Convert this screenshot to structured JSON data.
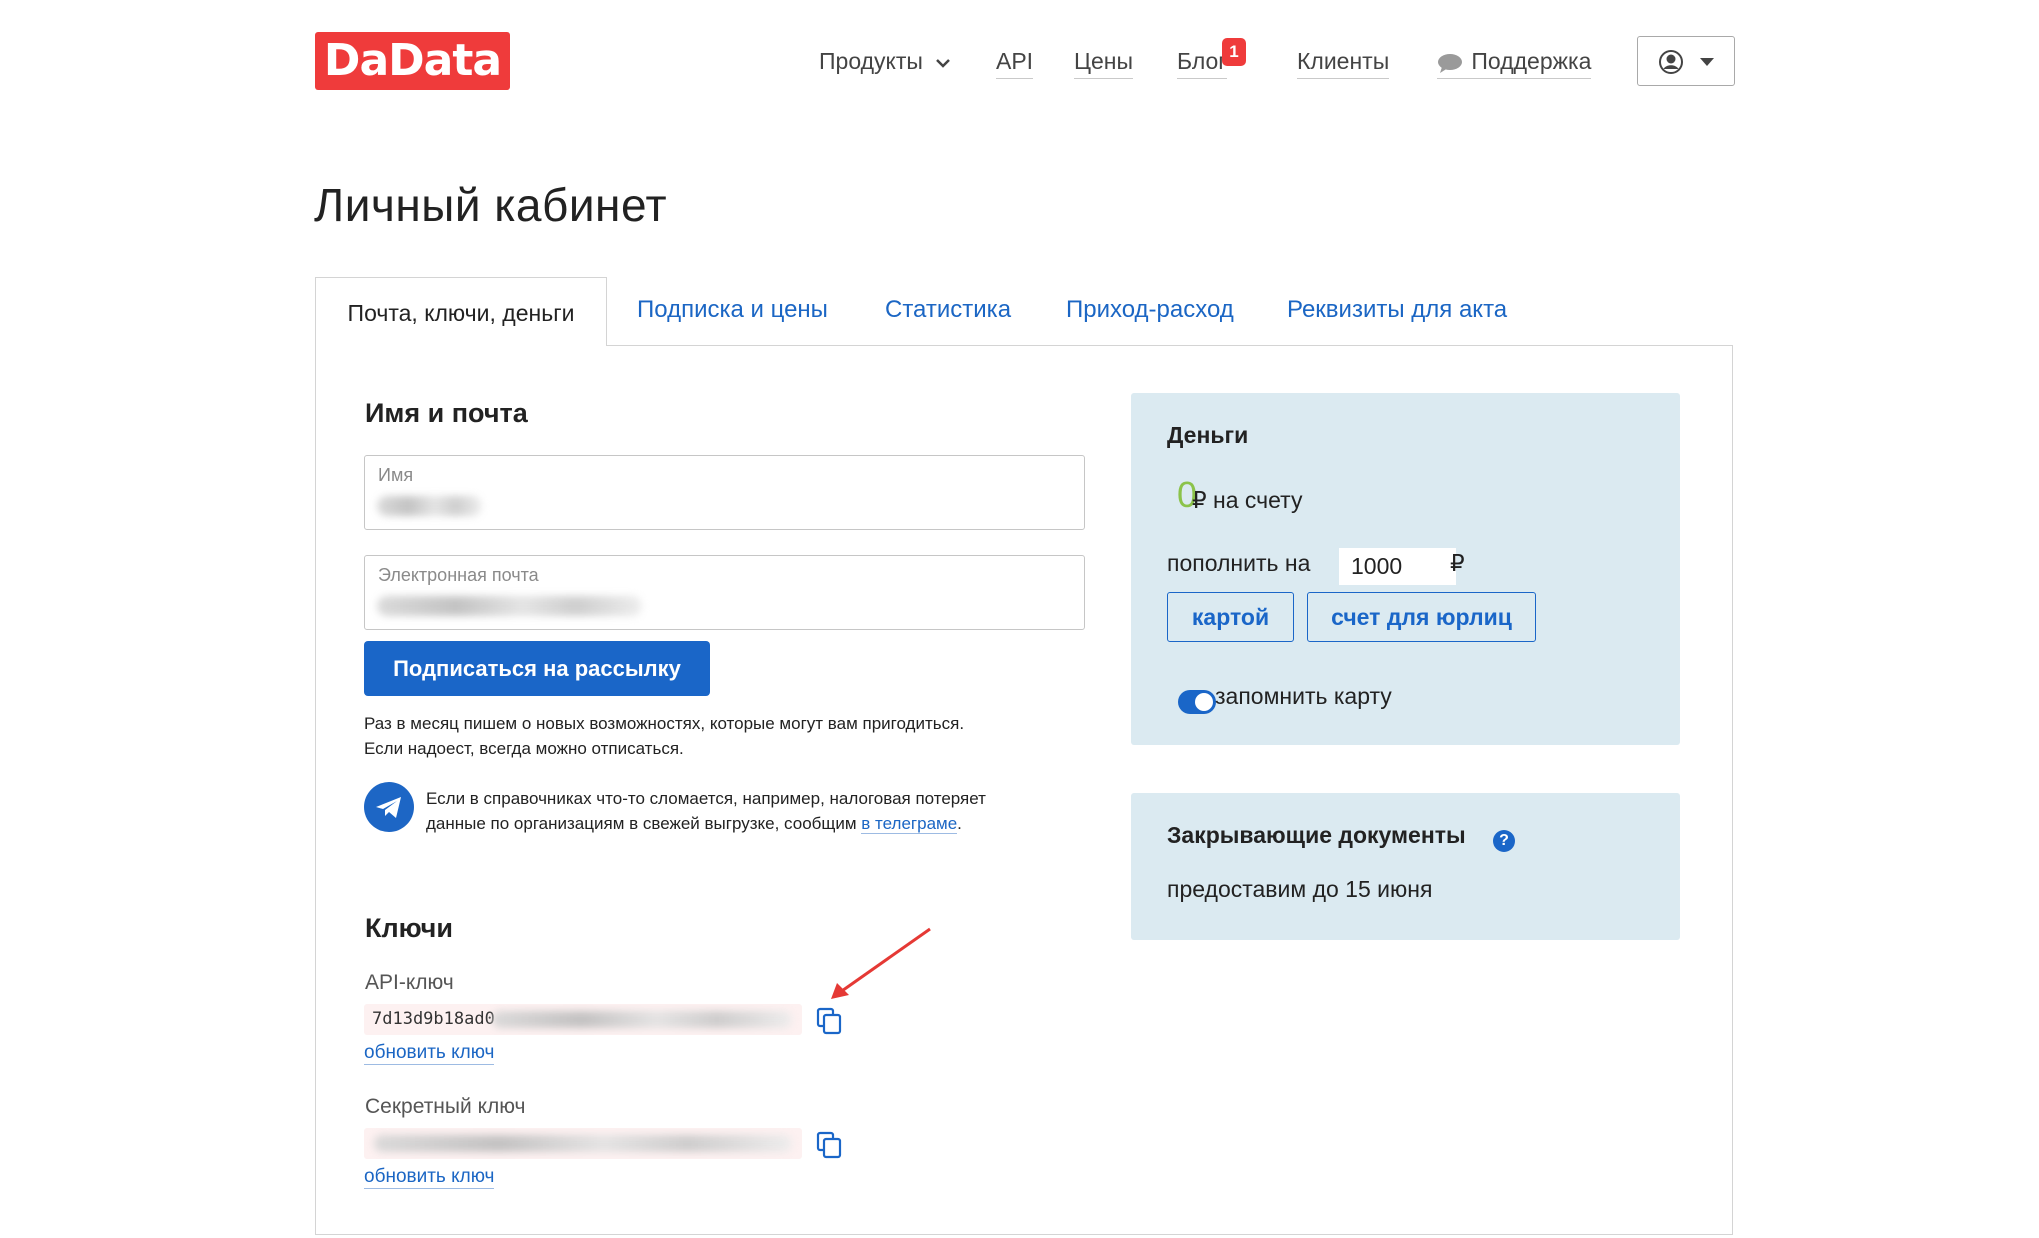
{
  "header": {
    "logo": "DaData",
    "nav": {
      "products": "Продукты",
      "api": "API",
      "prices": "Цены",
      "blog": "Блог",
      "blog_badge": "1",
      "clients": "Клиенты",
      "support": "Поддержка"
    }
  },
  "page": {
    "title": "Личный кабинет",
    "tabs": [
      {
        "label": "Почта, ключи, деньги",
        "active": true
      },
      {
        "label": "Подписка и цены"
      },
      {
        "label": "Статистика"
      },
      {
        "label": "Приход-расход"
      },
      {
        "label": "Реквизиты для акта"
      }
    ]
  },
  "profile": {
    "title": "Имя и почта",
    "name_label": "Имя",
    "email_label": "Электронная почта",
    "subscribe_button": "Подписаться на рассылку",
    "subscribe_note_1": "Раз в месяц пишем о новых возможностях, которые могут вам пригодиться.",
    "subscribe_note_2": "Если надоест, всегда можно отписаться.",
    "telegram_note_1": "Если в справочниках что-то сломается, например, налоговая потеряет",
    "telegram_note_2": "данные по организациям в свежей выгрузке, сообщим",
    "telegram_link": "в телеграме",
    "telegram_period": "."
  },
  "keys": {
    "title": "Ключи",
    "api_key_label": "API-ключ",
    "api_key_value": "7d13d9b18ad0",
    "refresh_api": "обновить ключ",
    "secret_key_label": "Секретный ключ",
    "refresh_secret": "обновить ключ"
  },
  "money": {
    "title": "Деньги",
    "balance": "0",
    "balance_suffix": "₽ на счету",
    "topup_label": "пополнить на",
    "topup_amount": "1000",
    "currency": "₽",
    "card_button": "картой",
    "invoice_button": "счет для юрлиц",
    "remember_card": "запомнить карту",
    "remember_card_on": true
  },
  "docs": {
    "title": "Закрывающие документы",
    "help_icon": "?",
    "note": "предоставим до 15 июня"
  },
  "colors": {
    "brand": "#ef3b3b",
    "accent": "#1a66c8",
    "card_bg": "#dbeaf1",
    "balance": "#8bc34a"
  }
}
